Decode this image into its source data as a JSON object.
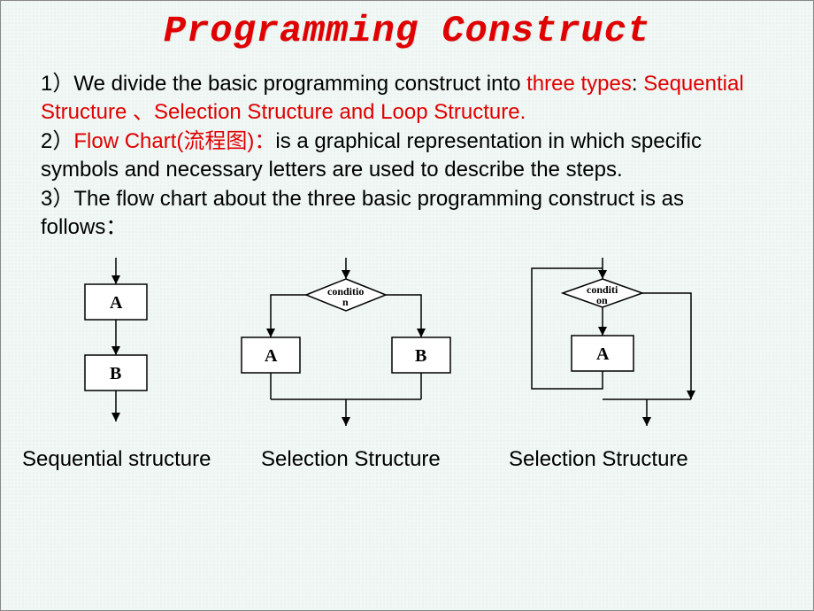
{
  "title": "Programming Construct",
  "p1": {
    "prefix": "1）We divide the basic programming construct into ",
    "three": "three types",
    "colon": ": ",
    "types": "Sequential Structure 、Selection Structure and  Loop Structure."
  },
  "p2": {
    "label": "2）",
    "flow": "Flow Chart(流程图)：",
    "rest": "is a graphical representation in which specific symbols and necessary letters are used to describe the steps."
  },
  "p3": "3）The flow chart about the three basic programming construct is as follows：",
  "boxes": {
    "A": "A",
    "B": "B",
    "cond1": "conditio",
    "cond1b": "n",
    "cond2": "conditi",
    "cond2b": "on"
  },
  "captions": {
    "c1": "Sequential structure",
    "c2": "Selection Structure",
    "c3": "Selection Structure"
  }
}
